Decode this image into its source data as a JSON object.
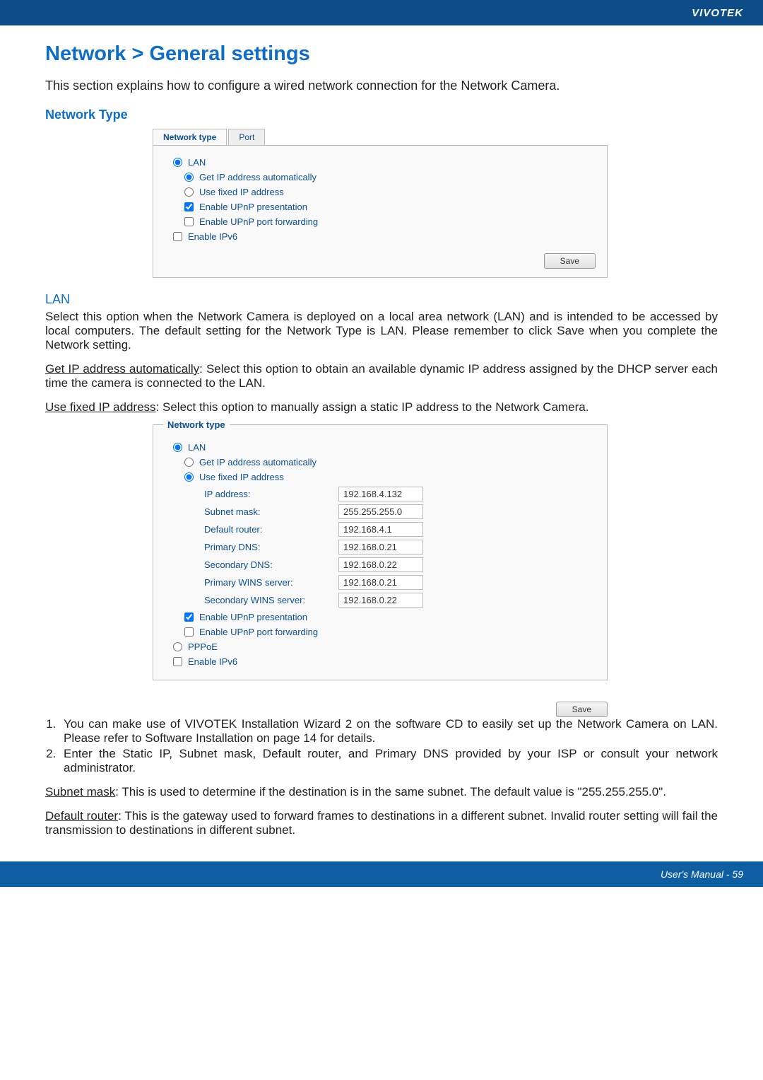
{
  "header": {
    "brand": "VIVOTEK"
  },
  "title": "Network > General settings",
  "intro": "This section explains how to configure a wired network connection for the Network Camera.",
  "section_network_type": "Network Type",
  "panel1": {
    "tabs": {
      "network_type": "Network type",
      "port": "Port"
    },
    "lan": "LAN",
    "get_ip": "Get IP address automatically",
    "use_fixed": "Use fixed IP address",
    "upnp_pres": "Enable UPnP presentation",
    "upnp_port": "Enable UPnP port forwarding",
    "ipv6": "Enable IPv6",
    "save": "Save"
  },
  "lan_heading": "LAN",
  "lan_para": "Select this option when the Network Camera is deployed on a local area network (LAN) and is intended to be accessed by local computers. The default setting for the Network Type is LAN. Please remember to click Save when you complete the Network setting.",
  "get_ip_label": "Get IP address automatically",
  "get_ip_para": ": Select this option to obtain an available dynamic IP address assigned by the DHCP server each time the camera is connected to the LAN.",
  "use_fixed_label": "Use fixed IP address",
  "use_fixed_para": ": Select this option to manually assign a static IP address to the Network Camera.",
  "panel2": {
    "legend": "Network type",
    "lan": "LAN",
    "get_ip": "Get IP address automatically",
    "use_fixed": "Use fixed IP address",
    "ip_addr_label": "IP address:",
    "ip_addr": "192.168.4.132",
    "subnet_label": "Subnet mask:",
    "subnet": "255.255.255.0",
    "router_label": "Default router:",
    "router": "192.168.4.1",
    "pdns_label": "Primary DNS:",
    "pdns": "192.168.0.21",
    "sdns_label": "Secondary DNS:",
    "sdns": "192.168.0.22",
    "pwins_label": "Primary WINS server:",
    "pwins": "192.168.0.21",
    "swins_label": "Secondary WINS server:",
    "swins": "192.168.0.22",
    "upnp_pres": "Enable UPnP presentation",
    "upnp_port": "Enable UPnP port forwarding",
    "pppoe": "PPPoE",
    "ipv6": "Enable IPv6",
    "save": "Save"
  },
  "note1": "You can make use of VIVOTEK Installation Wizard 2 on the software CD to easily set up the Network Camera on LAN. Please refer to Software Installation on page 14 for details.",
  "note2": "Enter the Static IP, Subnet mask, Default router, and Primary DNS provided by your ISP or consult your network administrator.",
  "subnet_label": "Subnet mask",
  "subnet_para": ": This is used to determine if the destination is in the same subnet. The default value is \"255.255.255.0\".",
  "router_label": "Default router",
  "router_para": ": This is the gateway used to forward frames to destinations in a different subnet. Invalid router setting will fail the transmission to destinations in different subnet.",
  "footer": "User's Manual - 59"
}
